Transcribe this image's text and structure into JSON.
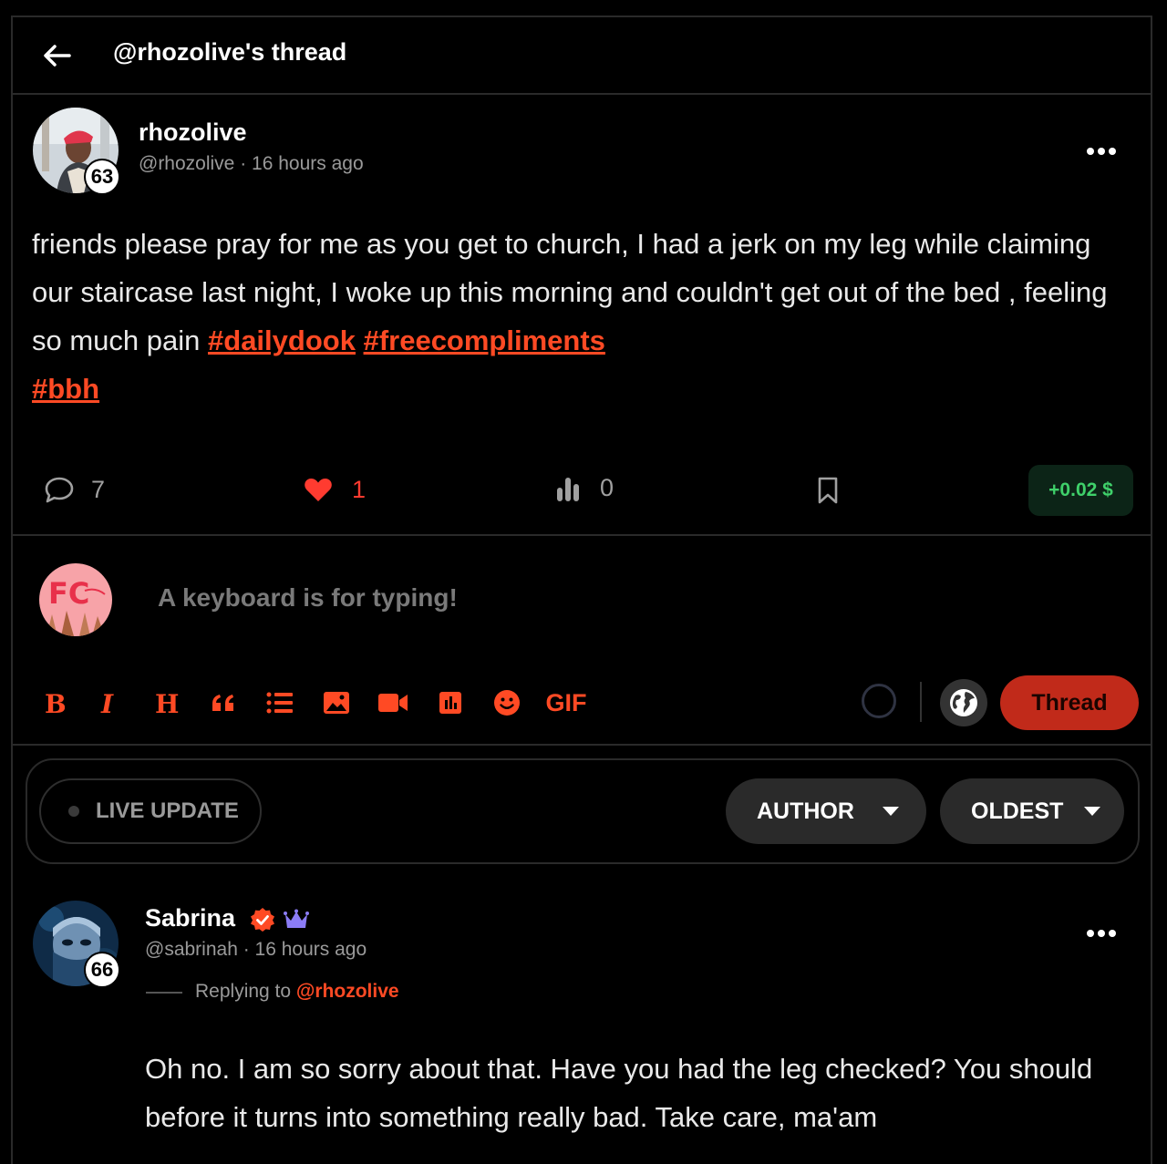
{
  "header": {
    "title": "@rhozolive's thread"
  },
  "post": {
    "author_name": "rhozolive",
    "author_handle": "@rhozolive",
    "time": "16 hours ago",
    "reputation": "63",
    "text_plain": "friends please pray for me as you get to church, I had a jerk on my leg while claiming our staircase last night, I woke up this morning and couldn't get out of the bed , feeling so much pain",
    "tags": [
      "#dailydook",
      "#freecompliments",
      "#bbh"
    ],
    "comments_count": "7",
    "likes_count": "1",
    "views_count": "0",
    "reward": "+0.02 $"
  },
  "composer": {
    "placeholder": "A keyboard is for typing!",
    "gif_label": "GIF",
    "submit_label": "Thread"
  },
  "filters": {
    "live_label": "LIVE UPDATE",
    "author_label": "AUTHOR",
    "order_label": "OLDEST"
  },
  "comment": {
    "author_name": "Sabrina",
    "author_handle": "@sabrinah",
    "time": "16 hours ago",
    "reputation": "66",
    "replying_prefix": "Replying to",
    "replying_to": "@rhozolive",
    "text": "Oh no. I am so sorry about that. Have you had the leg checked? You should before it turns into something really bad. Take care, ma'am"
  },
  "colors": {
    "accent": "#ff4a24",
    "button": "#c12a1a",
    "reward_text": "#3fd06a",
    "like": "#ff3b30",
    "crown": "#8b7cf6"
  }
}
